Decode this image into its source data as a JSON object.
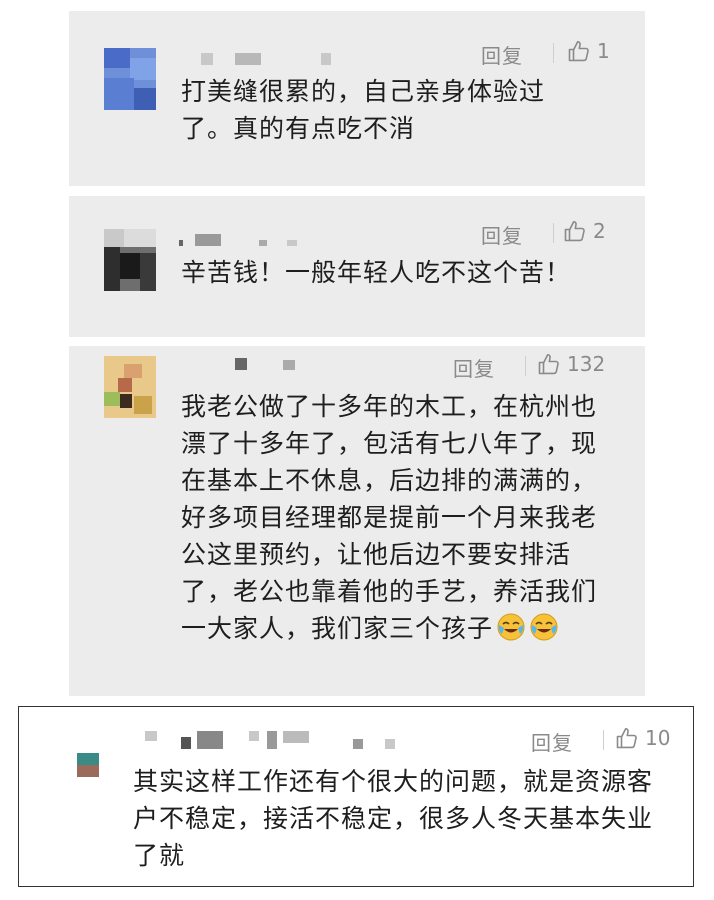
{
  "comments": [
    {
      "reply_label": "回复",
      "like_count": "1",
      "text": "打美缝很累的，自己亲身体验过了。真的有点吃不消"
    },
    {
      "reply_label": "回复",
      "like_count": "2",
      "text": "辛苦钱！一般年轻人吃不这个苦！"
    },
    {
      "reply_label": "回复",
      "like_count": "132",
      "text": "我老公做了十多年的木工，在杭州也漂了十多年了，包活有七八年了，现在基本上不休息，后边排的满满的，好多项目经理都是提前一个月来我老公这里预约，让他后边不要安排活了，老公也靠着他的手艺，养活我们一大家人，我们家三个孩子",
      "emojis": [
        "crying-laughing-face",
        "crying-laughing-face"
      ]
    },
    {
      "reply_label": "回复",
      "like_count": "10",
      "text": "其实这样工作还有个很大的问题，就是资源客户不稳定，接活不稳定，很多人冬天基本失业了就"
    }
  ]
}
